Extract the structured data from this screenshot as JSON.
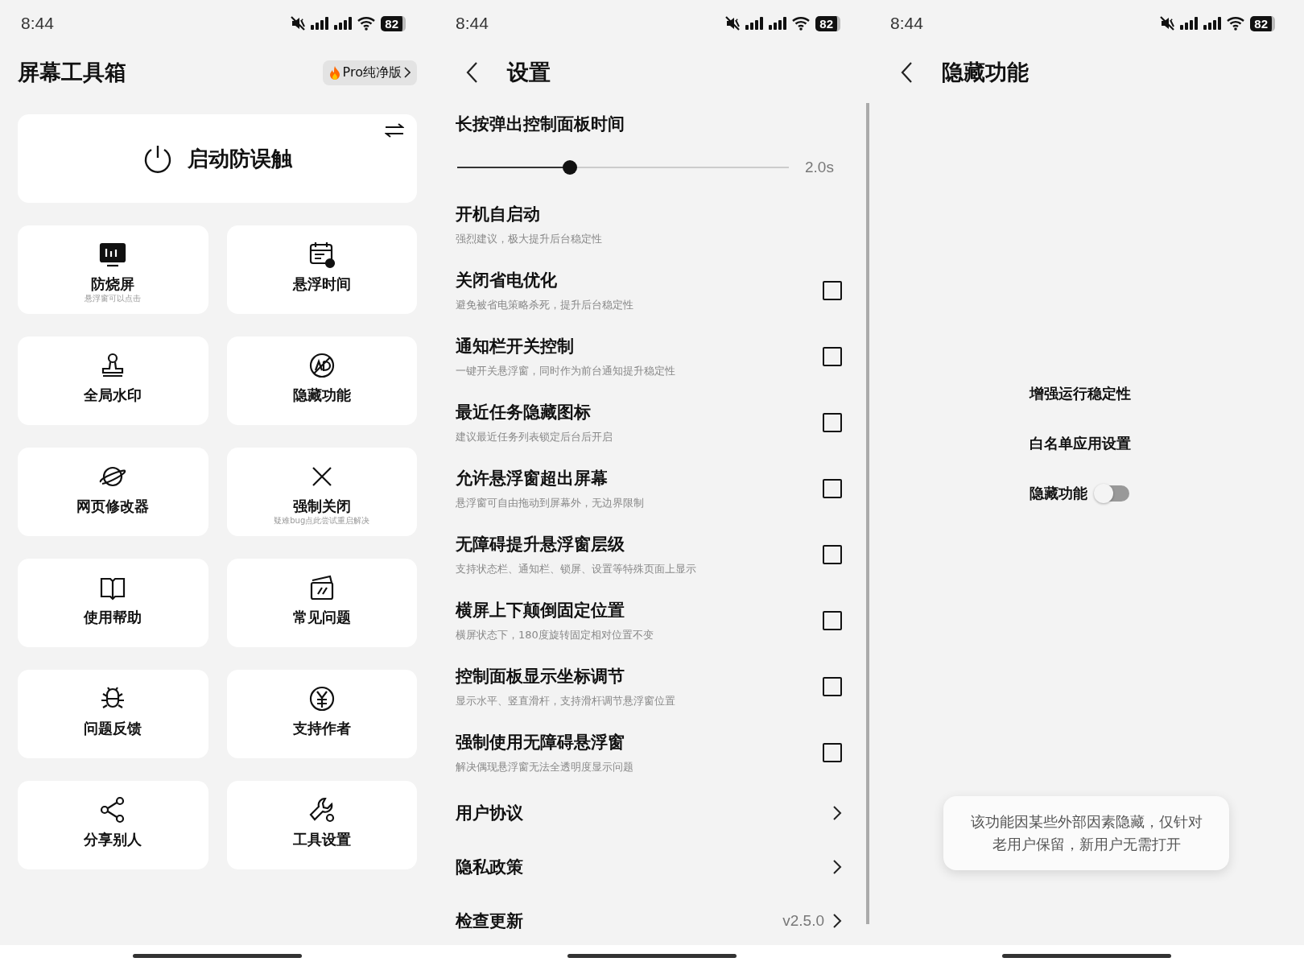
{
  "home": {
    "status_bar": {
      "time": "8:44",
      "battery": "82"
    },
    "title": "屏幕工具箱",
    "pro_badge": {
      "label": "Pro纯净版"
    },
    "main_button": {
      "label": "启动防误触"
    },
    "tiles": [
      {
        "label": "防烧屏",
        "subtitle": "悬浮窗可以点击"
      },
      {
        "label": "悬浮时间"
      },
      {
        "label": "全局水印"
      },
      {
        "label": "隐藏功能"
      },
      {
        "label": "网页修改器"
      },
      {
        "label": "强制关闭",
        "subtitle": "疑难bug点此尝试重启解决"
      },
      {
        "label": "使用帮助"
      },
      {
        "label": "常见问题"
      },
      {
        "label": "问题反馈"
      },
      {
        "label": "支持作者"
      },
      {
        "label": "分享别人"
      },
      {
        "label": "工具设置"
      }
    ]
  },
  "settings": {
    "status_bar": {
      "time": "8:44",
      "battery": "82"
    },
    "title": "设置",
    "slider": {
      "label": "长按弹出控制面板时间",
      "level": 0.34,
      "reading": "2.0s"
    },
    "options": [
      {
        "kind": "plain",
        "title": "开机自启动",
        "subtitle": "强烈建议，极大提升后台稳定性"
      },
      {
        "kind": "checkbox",
        "title": "关闭省电优化",
        "subtitle": "避免被省电策略杀死，提升后台稳定性",
        "checked": false
      },
      {
        "kind": "checkbox",
        "title": "通知栏开关控制",
        "subtitle": "一键开关悬浮窗，同时作为前台通知提升稳定性",
        "checked": false
      },
      {
        "kind": "checkbox",
        "title": "最近任务隐藏图标",
        "subtitle": "建议最近任务列表锁定后台后开启",
        "checked": false
      },
      {
        "kind": "checkbox",
        "title": "允许悬浮窗超出屏幕",
        "subtitle": "悬浮窗可自由拖动到屏幕外，无边界限制",
        "checked": false
      },
      {
        "kind": "checkbox",
        "title": "无障碍提升悬浮窗层级",
        "subtitle": "支持状态栏、通知栏、锁屏、设置等特殊页面上显示",
        "checked": false
      },
      {
        "kind": "checkbox",
        "title": "横屏上下颠倒固定位置",
        "subtitle": "横屏状态下，180度旋转固定相对位置不变",
        "checked": false
      },
      {
        "kind": "checkbox",
        "title": "控制面板显示坐标调节",
        "subtitle": "显示水平、竖直滑杆，支持滑杆调节悬浮窗位置",
        "checked": false
      },
      {
        "kind": "checkbox",
        "title": "强制使用无障碍悬浮窗",
        "subtitle": "解决偶现悬浮窗无法全透明度显示问题",
        "checked": false
      }
    ],
    "links": [
      {
        "label": "用户协议"
      },
      {
        "label": "隐私政策"
      },
      {
        "label": "检查更新",
        "value": "v2.5.0"
      }
    ]
  },
  "hidden": {
    "status_bar": {
      "time": "8:44",
      "battery": "82"
    },
    "title": "隐藏功能",
    "items": [
      {
        "kind": "text",
        "label": "增强运行稳定性"
      },
      {
        "kind": "text",
        "label": "白名单应用设置"
      },
      {
        "kind": "toggle",
        "label": "隐藏功能",
        "on": false
      }
    ],
    "toast": "该功能因某些外部因素隐藏，仅针对老用户保留，新用户无需打开"
  }
}
